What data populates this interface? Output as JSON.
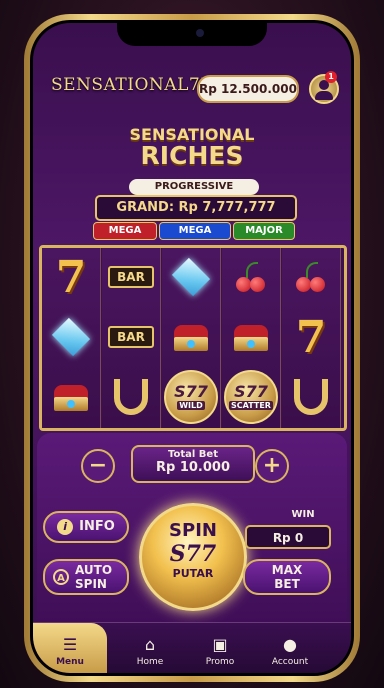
{
  "header": {
    "logo": "SENSATIONAL77",
    "balance": "Rp 12.500.000",
    "notification_count": "1"
  },
  "game": {
    "title_line1": "SENSATIONAL",
    "title_line2": "RICHES",
    "jackpot_label": "PROGRESSIVE JACKPOT",
    "jackpot_value": "GRAND: Rp 7,777,777",
    "tiers": [
      {
        "label": "MEGA",
        "color": "#c0202a"
      },
      {
        "label": "MEGA",
        "color": "#1a4ad0"
      },
      {
        "label": "MAJOR",
        "color": "#2a8a2a"
      }
    ]
  },
  "reels": [
    [
      "seven",
      "diamond",
      "crown"
    ],
    [
      "bar",
      "bar",
      "horseshoe"
    ],
    [
      "diamond",
      "crown",
      "wild"
    ],
    [
      "cherry",
      "crown",
      "scatter"
    ],
    [
      "cherry",
      "seven",
      "horseshoe"
    ]
  ],
  "symbols": {
    "bar_text": "BAR",
    "seven_text": "7",
    "wild_label": "WILD",
    "scatter_label": "SCATTER",
    "coin_text": "S77"
  },
  "controls": {
    "minus": "−",
    "plus": "+",
    "total_bet_label": "Total Bet",
    "total_bet_value": "Rp 10.000",
    "info_label": "INFO",
    "auto_spin_label_1": "AUTO",
    "auto_spin_label_2": "SPIN",
    "spin_label": "SPIN",
    "spin_logo": "S77",
    "spin_sub": "PUTAR",
    "win_label": "WIN",
    "win_value": "Rp 0",
    "max_bet_label_1": "MAX",
    "max_bet_label_2": "BET"
  },
  "nav": [
    {
      "label": "Menu",
      "icon": "menu-icon"
    },
    {
      "label": "Home",
      "icon": "home-icon"
    },
    {
      "label": "Promo",
      "icon": "gift-icon"
    },
    {
      "label": "Account",
      "icon": "account-icon"
    }
  ],
  "colors": {
    "gold": "#f3d98a",
    "purple": "#4d1766",
    "accent_red": "#c0202a"
  }
}
